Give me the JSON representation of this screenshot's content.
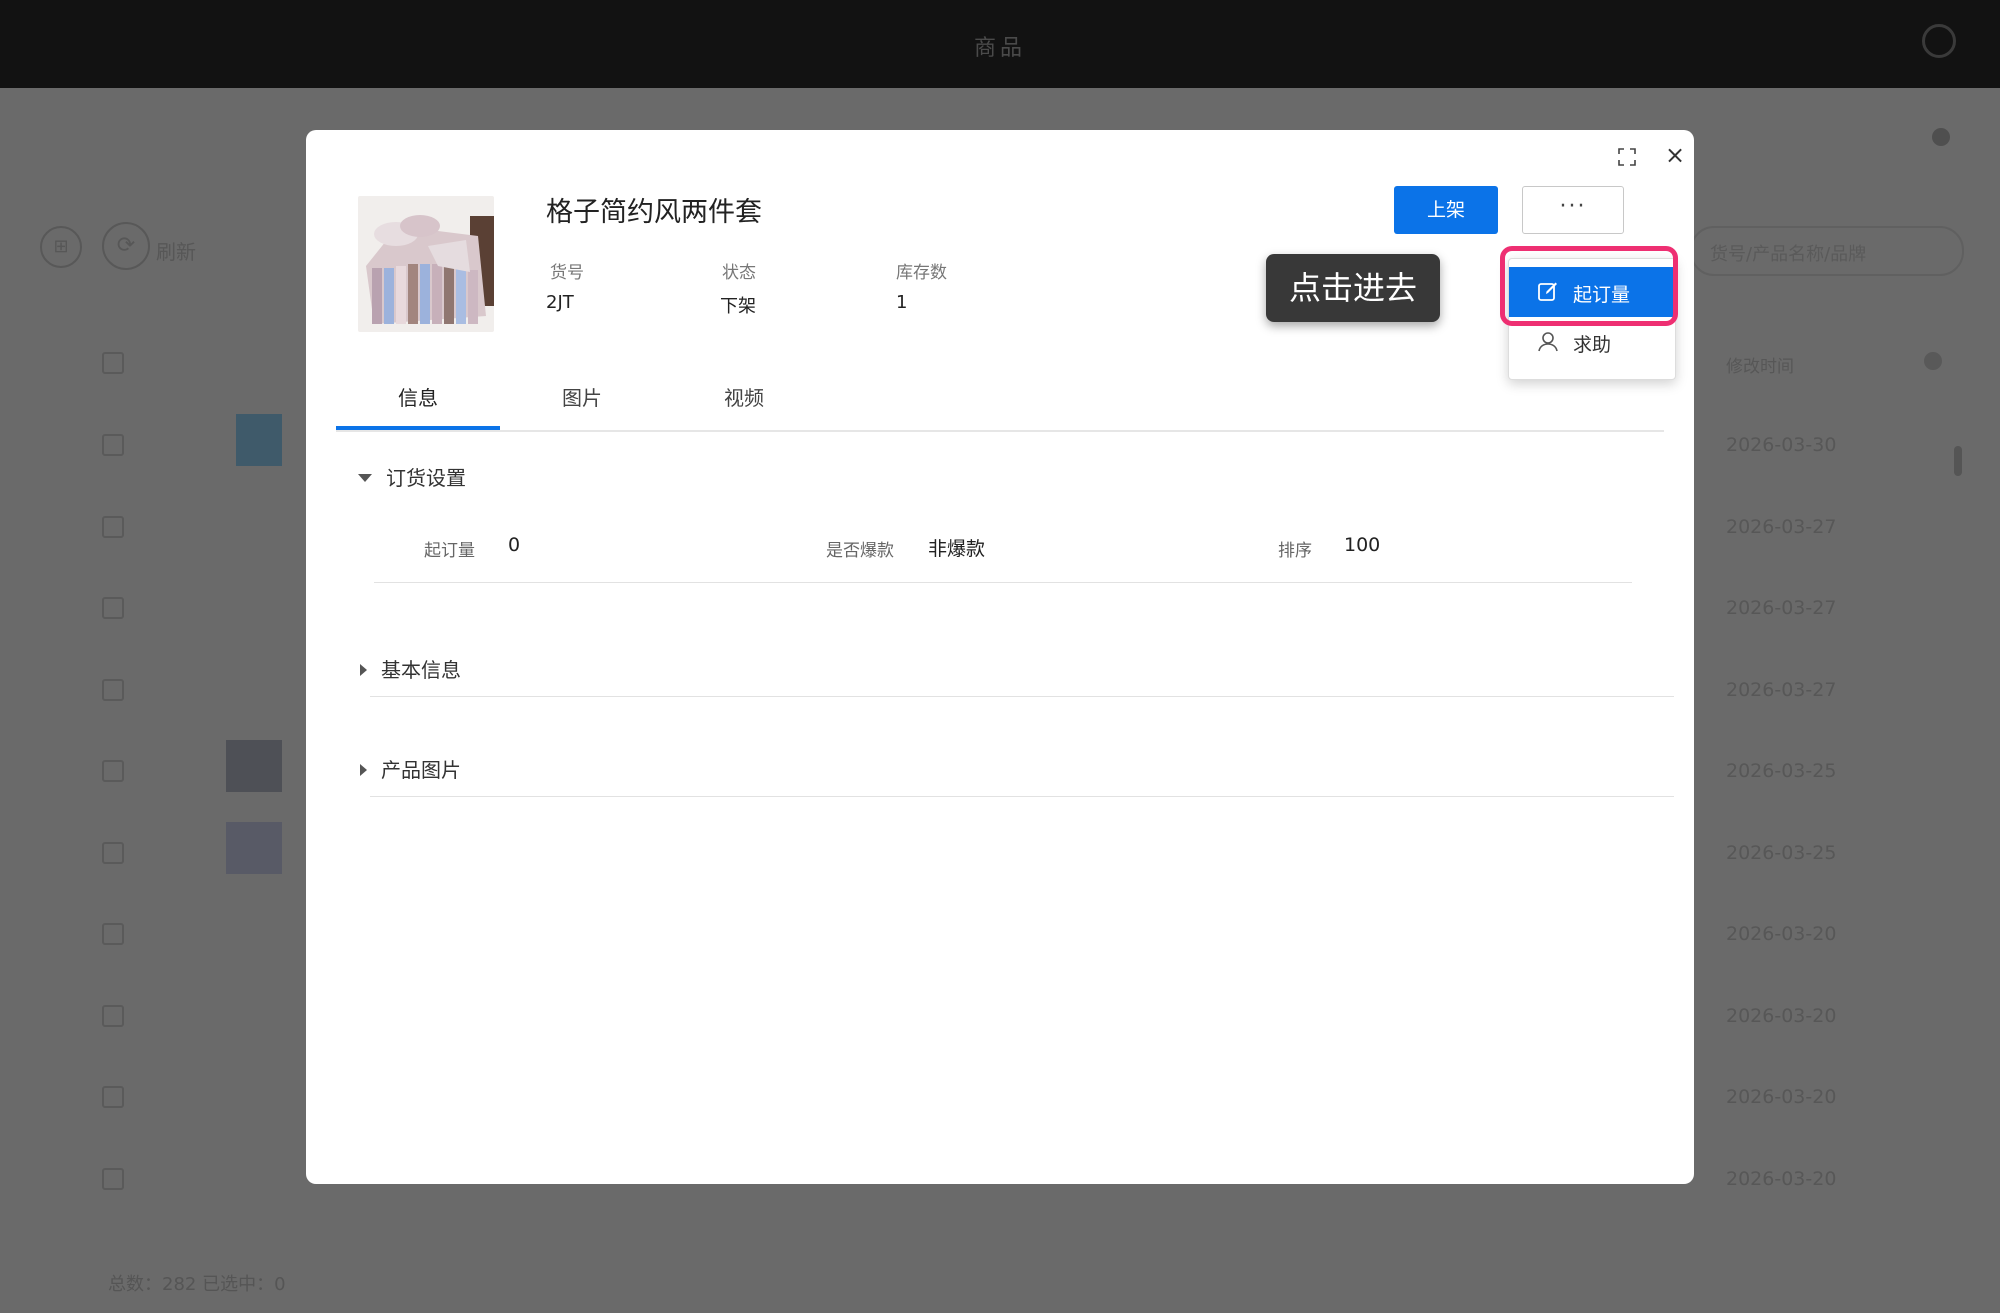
{
  "background": {
    "window_title": "商品",
    "refresh_label": "刷新",
    "search_placeholder": "货号/产品名称/品牌",
    "column_modified": "修改时间",
    "rows": [
      "2026-03-30",
      "2026-03-27",
      "2026-03-27",
      "2026-03-27",
      "2026-03-25",
      "2026-03-25",
      "2026-03-20",
      "2026-03-20",
      "2026-03-20",
      "2026-03-20"
    ],
    "footer": "总数：282    已选中：0"
  },
  "modal": {
    "product_title": "格子简约风两件套",
    "meta": {
      "sku_label": "货号",
      "sku_value": "2JT",
      "status_label": "状态",
      "status_value": "下架",
      "stock_label": "库存数",
      "stock_value": "1"
    },
    "actions": {
      "primary": "上架",
      "more": "···"
    },
    "dropdown": {
      "item1": "起订量",
      "item2": "求助"
    },
    "tooltip": "点击进去",
    "tabs": [
      "信息",
      "图片",
      "视频"
    ],
    "sections": {
      "order_settings": "订货设置",
      "basic_info": "基本信息",
      "product_images": "产品图片"
    },
    "fields": {
      "moq_label": "起订量",
      "moq_value": "0",
      "hot_label": "是否爆款",
      "hot_value": "非爆款",
      "sort_label": "排序",
      "sort_value": "100"
    }
  },
  "colors": {
    "accent": "#0b73e8",
    "highlight": "#ee2f72",
    "tooltip_bg": "#383838"
  }
}
